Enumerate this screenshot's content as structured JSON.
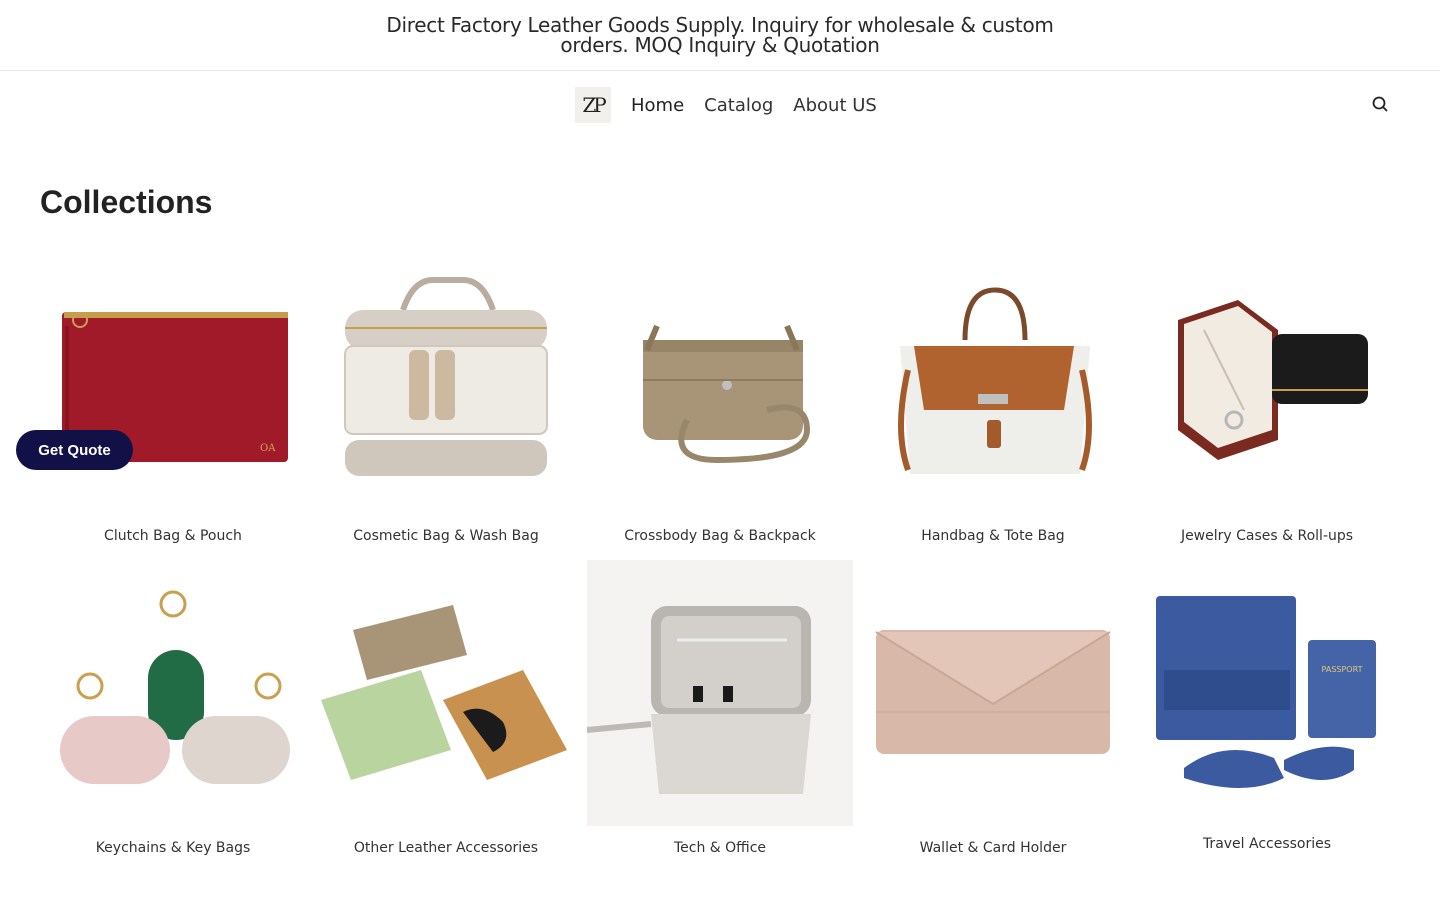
{
  "announcement": {
    "text": "Direct Factory Leather Goods Supply. Inquiry for wholesale & custom orders. MOQ Inquiry & Quotation"
  },
  "header": {
    "logo_text": "ZP",
    "nav": [
      "Home",
      "Catalog",
      "About US"
    ],
    "search_icon": "search-icon"
  },
  "page": {
    "title": "Collections"
  },
  "collections": [
    "Clutch Bag & Pouch",
    "Cosmetic Bag & Wash Bag",
    "Crossbody Bag & Backpack",
    "Handbag & Tote Bag",
    "Jewelry Cases & Roll-ups",
    "Keychains & Key Bags",
    "Other Leather Accessories",
    "Tech & Office",
    "Wallet & Card Holder",
    "Travel Accessories"
  ],
  "product_marks": {
    "clutch_monogram": "OA",
    "passport_text": "PASSPORT"
  },
  "floating": {
    "get_quote": "Get Quote"
  },
  "colors": {
    "button_bg": "#111148",
    "clutch": "#a01a2a",
    "tan": "#a89477",
    "green": "#216b45",
    "navy_leather": "#3b5aa0"
  }
}
